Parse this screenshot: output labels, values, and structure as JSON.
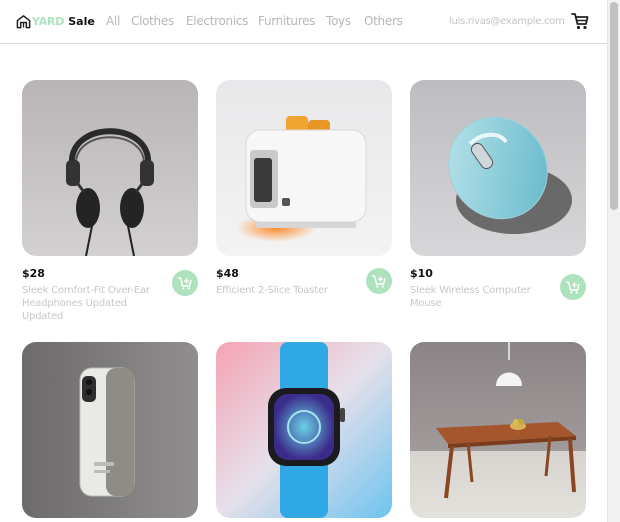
{
  "brand": {
    "part1": "YARD",
    "part2": "Sale",
    "accent_color": "#AEE2BD"
  },
  "nav": {
    "links": [
      "All",
      "Clothes",
      "Electronics",
      "Furnitures",
      "Toys",
      "Others"
    ],
    "email": "luis.rivas@example.com",
    "cart_icon": "shopping-cart-icon"
  },
  "products": [
    {
      "price": "$28",
      "title": "Sleek Comfort-Fit Over-Ear Headphones Updated Updated",
      "image": "headphones",
      "action_icon": "add-to-cart-icon"
    },
    {
      "price": "$48",
      "title": "Efficient 2-Slice Toaster",
      "image": "toaster",
      "action_icon": "add-to-cart-icon"
    },
    {
      "price": "$10",
      "title": "Sleek Wireless Computer Mouse",
      "image": "mouse",
      "action_icon": "add-to-cart-icon"
    },
    {
      "price": "",
      "title": "",
      "image": "smartphone",
      "action_icon": "add-to-cart-icon"
    },
    {
      "price": "",
      "title": "",
      "image": "smartwatch",
      "action_icon": "add-to-cart-icon"
    },
    {
      "price": "",
      "title": "",
      "image": "dining-table",
      "action_icon": "add-to-cart-icon"
    }
  ]
}
